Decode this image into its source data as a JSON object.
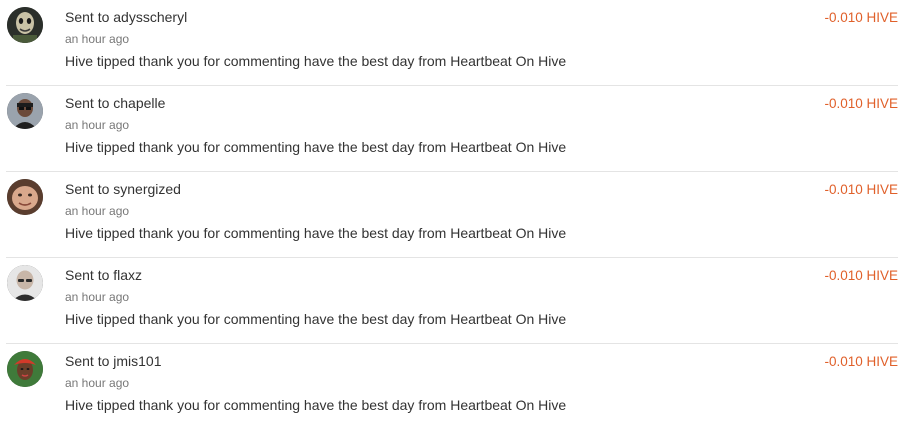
{
  "transfers": [
    {
      "prefix": "Sent to ",
      "user": "adysscheryl",
      "time": "an hour ago",
      "memo": "Hive tipped thank you for commenting have the best day from Heartbeat On Hive",
      "amount": "-0.010 HIVE",
      "avatar_icon": "avatar-mask-icon"
    },
    {
      "prefix": "Sent to ",
      "user": "chapelle",
      "time": "an hour ago",
      "memo": "Hive tipped thank you for commenting have the best day from Heartbeat On Hive",
      "amount": "-0.010 HIVE",
      "avatar_icon": "avatar-person-icon"
    },
    {
      "prefix": "Sent to ",
      "user": "synergized",
      "time": "an hour ago",
      "memo": "Hive tipped thank you for commenting have the best day from Heartbeat On Hive",
      "amount": "-0.010 HIVE",
      "avatar_icon": "avatar-face-icon"
    },
    {
      "prefix": "Sent to ",
      "user": "flaxz",
      "time": "an hour ago",
      "memo": "Hive tipped thank you for commenting have the best day from Heartbeat On Hive",
      "amount": "-0.010 HIVE",
      "avatar_icon": "avatar-bald-person-icon"
    },
    {
      "prefix": "Sent to ",
      "user": "jmis101",
      "time": "an hour ago",
      "memo": "Hive tipped thank you for commenting have the best day from Heartbeat On Hive",
      "amount": "-0.010 HIVE",
      "avatar_icon": "avatar-red-hat-person-icon"
    }
  ],
  "colors": {
    "amount": "#e0602a",
    "divider": "#e4e4e4",
    "muted": "#777777"
  }
}
